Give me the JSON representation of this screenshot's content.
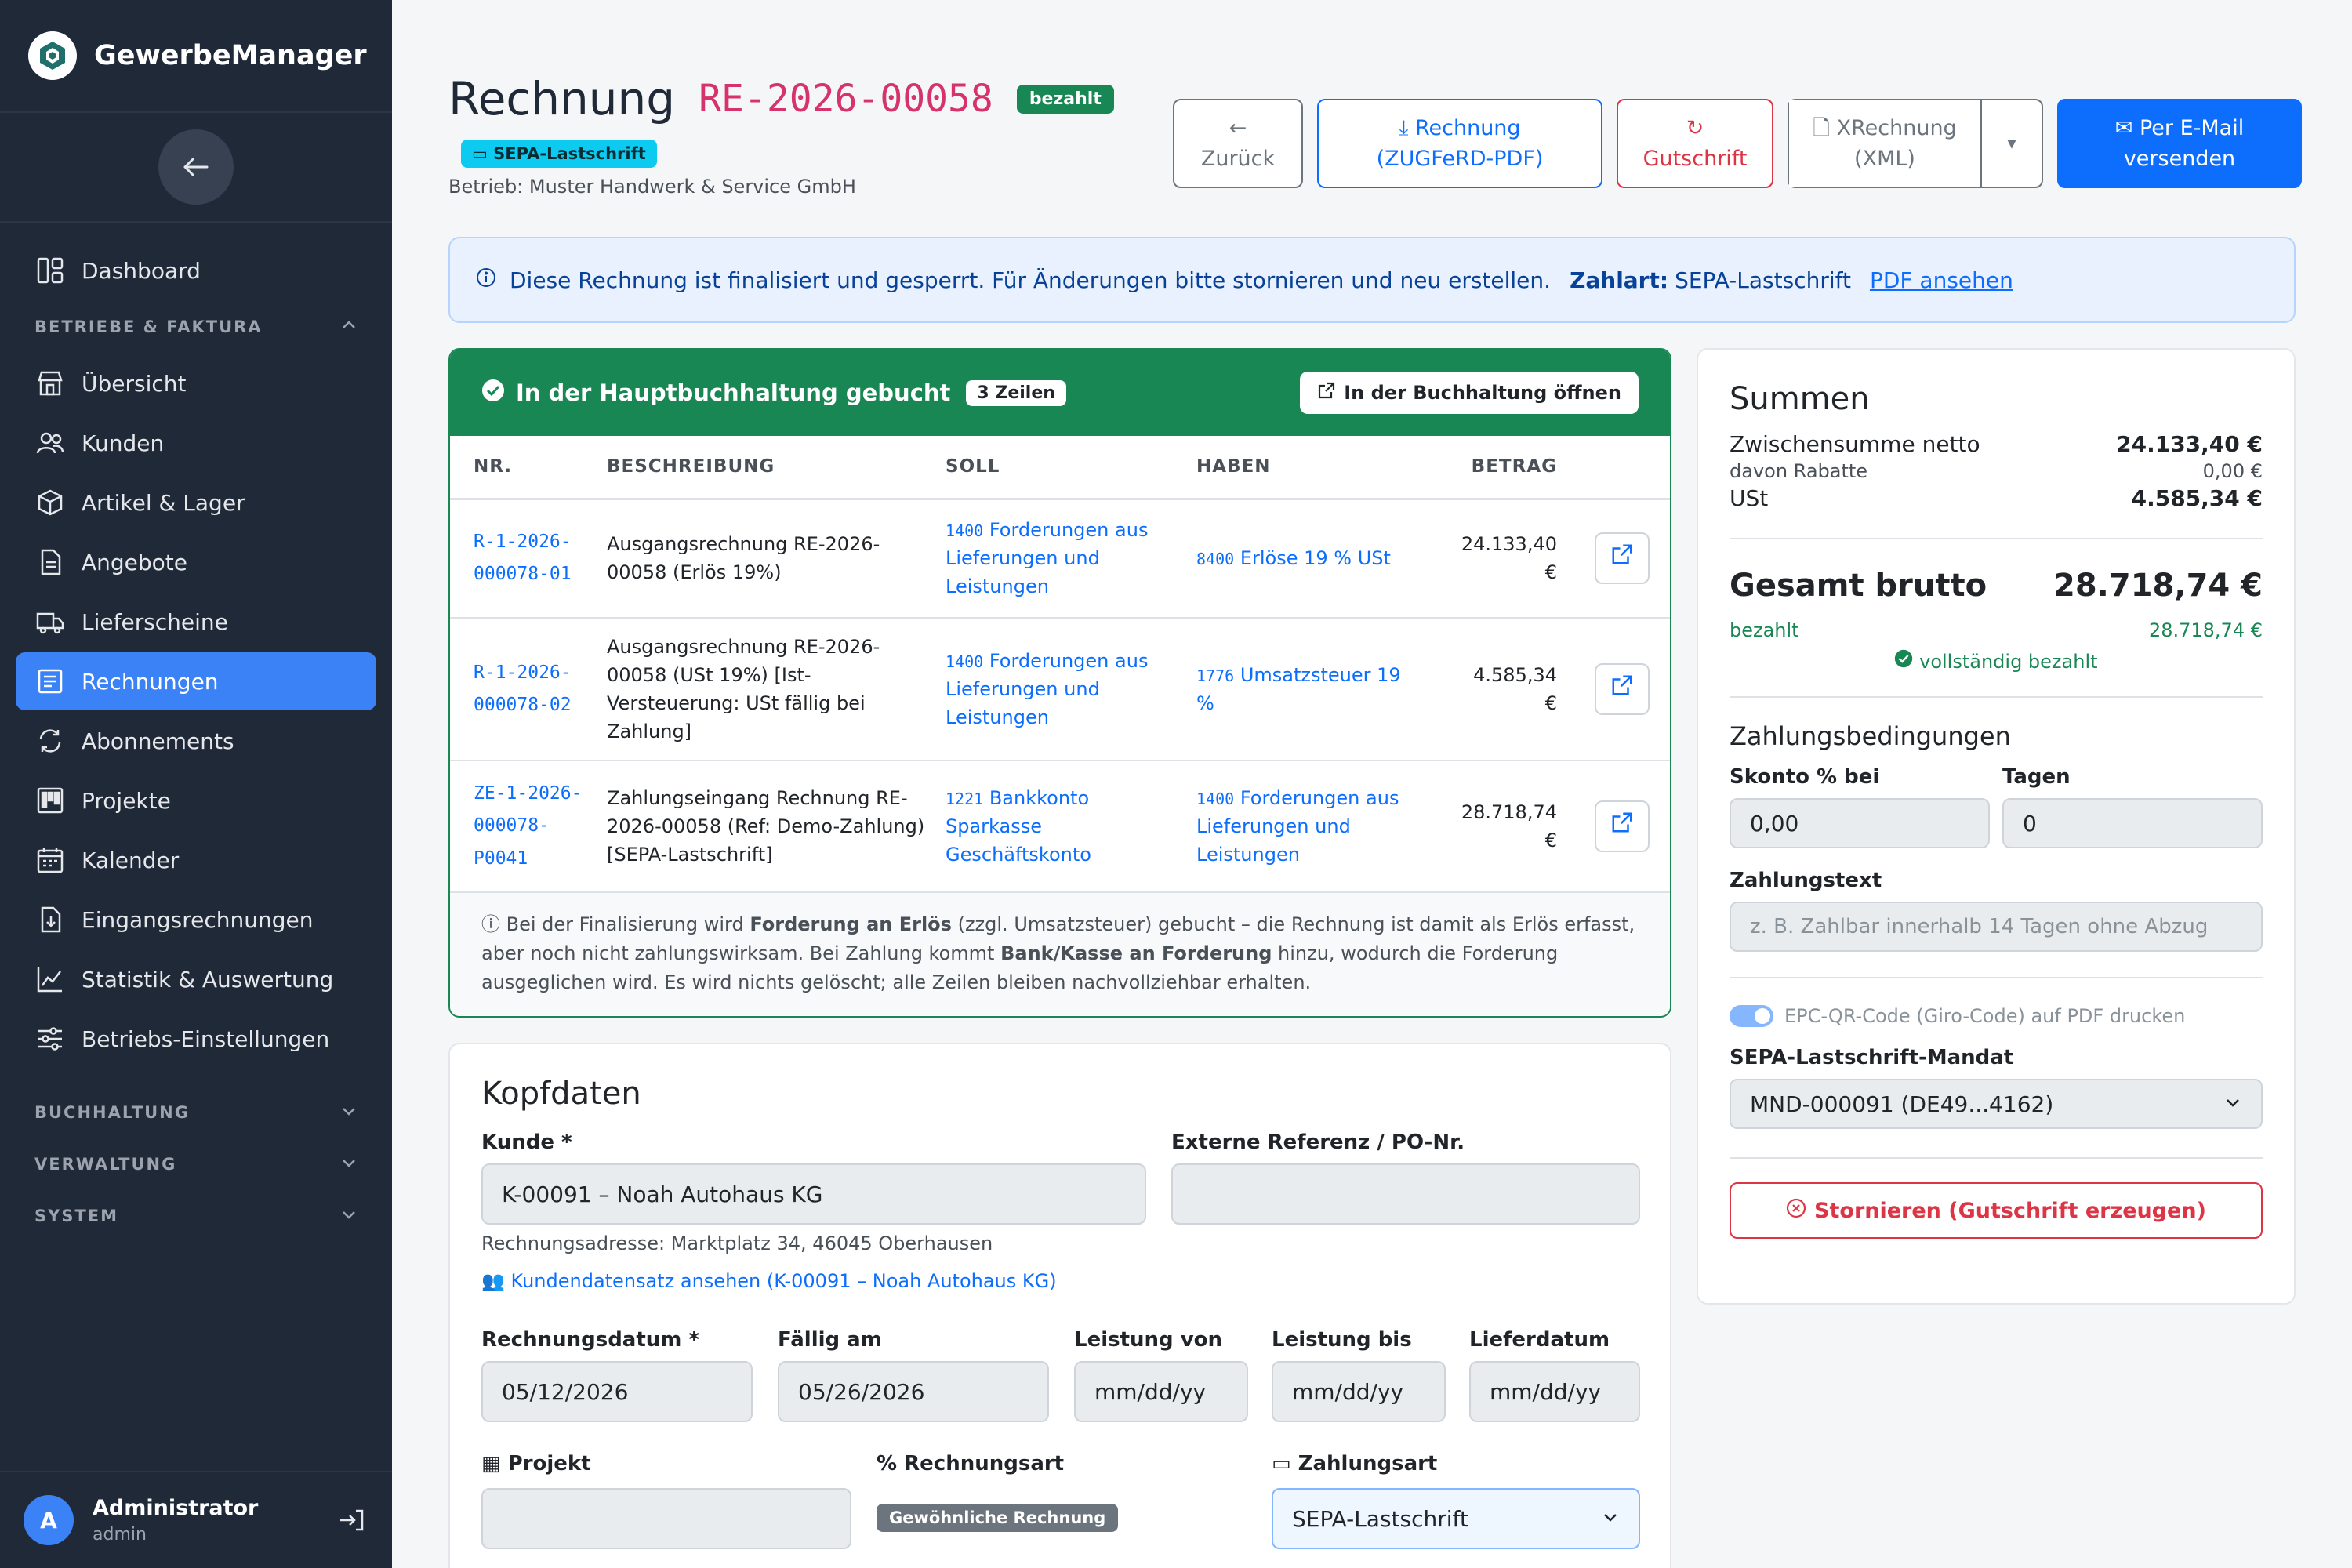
{
  "brand": {
    "name": "GewerbeManager"
  },
  "sidebar": {
    "items": [
      {
        "label": "Dashboard",
        "icon": "dashboard-icon"
      },
      {
        "label": "Übersicht",
        "icon": "shop-icon"
      },
      {
        "label": "Kunden",
        "icon": "people-icon"
      },
      {
        "label": "Artikel & Lager",
        "icon": "box-icon"
      },
      {
        "label": "Angebote",
        "icon": "document-icon"
      },
      {
        "label": "Lieferscheine",
        "icon": "truck-icon"
      },
      {
        "label": "Rechnungen",
        "icon": "receipt-icon"
      },
      {
        "label": "Abonnements",
        "icon": "repeat-icon"
      },
      {
        "label": "Projekte",
        "icon": "kanban-icon"
      },
      {
        "label": "Kalender",
        "icon": "calendar-icon"
      },
      {
        "label": "Eingangsrechnungen",
        "icon": "file-import-icon"
      },
      {
        "label": "Statistik & Auswertung",
        "icon": "chart-icon"
      },
      {
        "label": "Betriebs-Einstellungen",
        "icon": "sliders-icon"
      }
    ],
    "sections": {
      "betriebe": "BETRIEBE & FAKTURA",
      "buchhaltung": "BUCHHALTUNG",
      "verwaltung": "VERWALTUNG",
      "system": "SYSTEM"
    },
    "user": {
      "initial": "A",
      "name": "Administrator",
      "role": "admin"
    }
  },
  "header": {
    "title": "Rechnung",
    "invoice_no": "RE-2026-00058",
    "status": "bezahlt",
    "payment_badge": "SEPA-Lastschrift",
    "betrieb": "Betrieb: Muster Handwerk & Service GmbH"
  },
  "toolbar": {
    "back": "Zurück",
    "pdf_line1": "Rechnung",
    "pdf_line2": "(ZUGFeRD-PDF)",
    "gutschrift": "Gutschrift",
    "xr_line1": "XRechnung",
    "xr_line2": "(XML)",
    "mail_line1": "Per E-Mail",
    "mail_line2": "versenden"
  },
  "alert": {
    "text": "Diese Rechnung ist finalisiert und gesperrt. Für Änderungen bitte stornieren und neu erstellen.",
    "zahlart_label": "Zahlart:",
    "zahlart_value": "SEPA-Lastschrift",
    "link": "PDF ansehen"
  },
  "booking": {
    "title": "In der Hauptbuchhaltung gebucht",
    "count": "3 Zeilen",
    "open_btn": "In der Buchhaltung öffnen",
    "columns": [
      "NR.",
      "BESCHREIBUNG",
      "SOLL",
      "HABEN",
      "BETRAG"
    ],
    "rows": [
      {
        "nr1": "R-1-2026-",
        "nr2": "000078-01",
        "nr3": "",
        "desc": "Ausgangsrechnung RE-2026-00058 (Erlös 19%)",
        "soll_no": "1400",
        "soll": "Forderungen aus Lieferungen und Leistungen",
        "haben_no": "8400",
        "haben": "Erlöse 19 % USt",
        "betrag1": "24.133,40",
        "betrag2": "€"
      },
      {
        "nr1": "R-1-2026-",
        "nr2": "000078-02",
        "nr3": "",
        "desc": "Ausgangsrechnung RE-2026-00058 (USt 19%) [Ist-Versteuerung: USt fällig bei Zahlung]",
        "soll_no": "1400",
        "soll": "Forderungen aus Lieferungen und Leistungen",
        "haben_no": "1776",
        "haben": "Umsatzsteuer 19 %",
        "betrag1": "4.585,34",
        "betrag2": "€"
      },
      {
        "nr1": "ZE-1-2026-",
        "nr2": "000078-",
        "nr3": "P0041",
        "desc": "Zahlungseingang Rechnung RE-2026-00058 (Ref: Demo-Zahlung) [SEPA-Lastschrift]",
        "soll_no": "1221",
        "soll": "Bankkonto Sparkasse Geschäftskonto",
        "haben_no": "1400",
        "haben": "Forderungen aus Lieferungen und Leistungen",
        "betrag1": "28.718,74",
        "betrag2": "€"
      }
    ],
    "note_a": "Bei der Finalisierung wird ",
    "note_b": "Forderung an Erlös",
    "note_c": " (zzgl. Umsatzsteuer) gebucht – die Rechnung ist damit als Erlös erfasst, aber noch nicht zahlungswirksam. Bei Zahlung kommt ",
    "note_d": "Bank/Kasse an Forderung",
    "note_e": " hinzu, wodurch die Forderung ausgeglichen wird. Es wird nichts gelöscht; alle Zeilen bleiben nachvollziehbar erhalten."
  },
  "kopf": {
    "title": "Kopfdaten",
    "kunde_label": "Kunde *",
    "kunde_value": "K-00091 – Noah Autohaus KG",
    "extref_label": "Externe Referenz / PO-Nr.",
    "extref_value": "",
    "adresse": "Rechnungsadresse: Marktplatz 34, 46045 Oberhausen",
    "kunde_link": "Kundendatensatz ansehen (K-00091 – Noah Autohaus KG)",
    "rdatum_label": "Rechnungsdatum *",
    "rdatum_value": "05/12/2026",
    "faellig_label": "Fällig am",
    "faellig_value": "05/26/2026",
    "lvon_label": "Leistung von",
    "lbis_label": "Leistung bis",
    "ldatum_label": "Lieferdatum",
    "date_placeholder": "mm/dd/yy",
    "projekt_label": "Projekt",
    "rart_label": "Rechnungsart",
    "rart_value": "Gewöhnliche Rechnung",
    "zart_label": "Zahlungsart",
    "zart_value": "SEPA-Lastschrift"
  },
  "summen": {
    "title": "Summen",
    "netto_label": "Zwischensumme netto",
    "netto": "24.133,40 €",
    "rabatt_label": "davon Rabatte",
    "rabatt": "0,00 €",
    "ust_label": "USt",
    "ust": "4.585,34 €",
    "brutto_label": "Gesamt brutto",
    "brutto": "28.718,74 €",
    "bezahlt_label": "bezahlt",
    "bezahlt": "28.718,74 €",
    "status": "vollständig bezahlt",
    "zb_title": "Zahlungsbedingungen",
    "skonto_label": "Skonto % bei",
    "skonto": "0,00",
    "tage_label": "Tagen",
    "tage": "0",
    "ztext_label": "Zahlungstext",
    "ztext_placeholder": "z. B. Zahlbar innerhalb 14 Tagen ohne Abzug",
    "epc_label": "EPC-QR-Code (Giro-Code) auf PDF drucken",
    "mandat_label": "SEPA-Lastschrift-Mandat",
    "mandat_value": "MND-000091 (DE49...4162)",
    "storno": "Stornieren (Gutschrift erzeugen)"
  },
  "colors": {
    "primary": "#0d6efd",
    "success": "#198754",
    "danger": "#dc3545",
    "sidebar": "#1f2937"
  }
}
